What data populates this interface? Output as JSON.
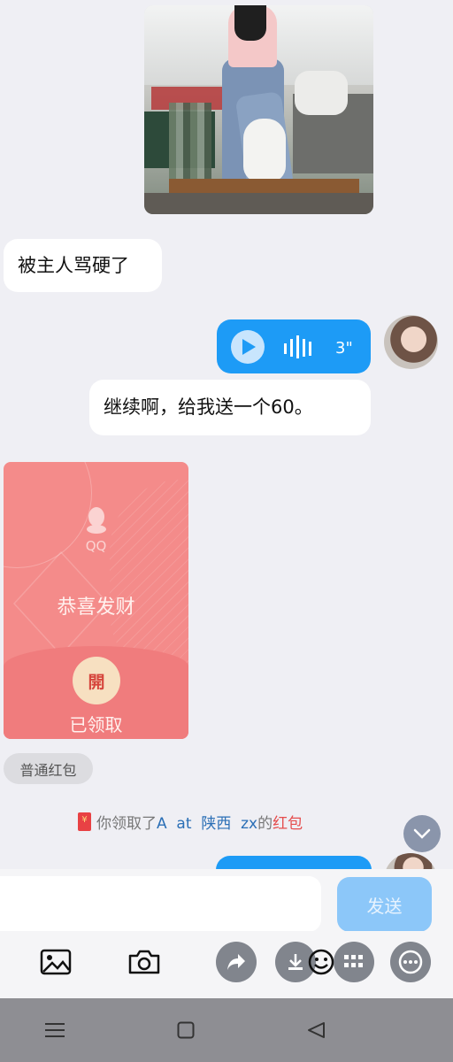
{
  "messages": {
    "text_1": "被主人骂硬了",
    "voice_duration": "3\"",
    "text_2": "继续啊，给我送一个60。"
  },
  "red_packet": {
    "logo_text": "QQ",
    "greeting": "恭喜发财",
    "open_label": "開",
    "status": "已领取",
    "type_tag": "普通红包"
  },
  "notice": {
    "prefix": "你领取了",
    "name": "A  at  陕西  zx",
    "mid": "的",
    "suffix": "红包"
  },
  "input": {
    "send_label": "发送"
  },
  "icons": {
    "toolbar": [
      "image-icon",
      "camera-icon",
      "share-icon",
      "download-icon",
      "emoji-icon",
      "grid-icon",
      "more-icon"
    ],
    "nav": [
      "menu-icon",
      "home-icon",
      "back-icon"
    ]
  },
  "colors": {
    "accent": "#1d9bf6",
    "red_packet": "#f48b8a",
    "send_disabled": "#8cc7f9"
  }
}
